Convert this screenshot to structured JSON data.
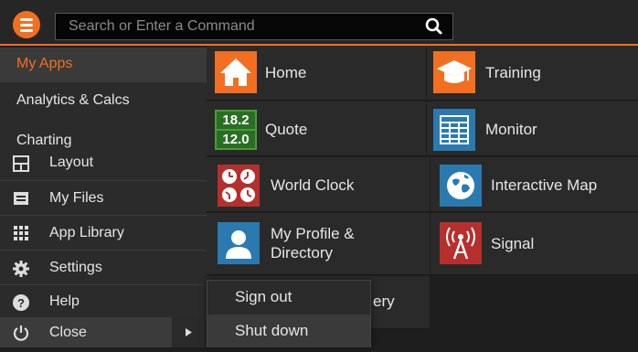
{
  "search": {
    "placeholder": "Search or Enter a Command"
  },
  "left_menu": {
    "sections": [
      "My Apps",
      "Analytics & Calcs",
      "Charting"
    ],
    "items": [
      {
        "label": "Layout",
        "icon": "layout-icon"
      },
      {
        "label": "My Files",
        "icon": "files-icon"
      },
      {
        "label": "App Library",
        "icon": "app-library-icon"
      },
      {
        "label": "Settings",
        "icon": "gear-icon"
      },
      {
        "label": "Help",
        "icon": "help-icon"
      },
      {
        "label": "Close",
        "icon": "power-icon"
      }
    ]
  },
  "apps": {
    "left": [
      {
        "label": "Home",
        "icon": "home-icon"
      },
      {
        "label": "Quote",
        "icon": "quote-icon",
        "icon_text": [
          "18.2",
          "12.0"
        ]
      },
      {
        "label": "World Clock",
        "icon": "world-clock-icon"
      },
      {
        "label_lines": [
          "My Profile &",
          "Directory"
        ],
        "icon": "profile-icon"
      },
      {
        "label_partial": "ery"
      }
    ],
    "right": [
      {
        "label": "Training",
        "icon": "training-icon"
      },
      {
        "label": "Monitor",
        "icon": "monitor-icon"
      },
      {
        "label": "Interactive Map",
        "icon": "globe-icon"
      },
      {
        "label": "Signal",
        "icon": "signal-icon"
      }
    ]
  },
  "popup": {
    "items": [
      "Sign out",
      "Shut down"
    ]
  },
  "colors": {
    "accent": "#f26f21",
    "background": "#1e1e1e",
    "tile": "#2a2a2a"
  }
}
